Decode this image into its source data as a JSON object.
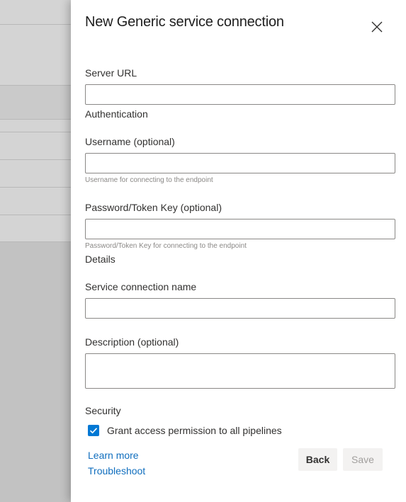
{
  "dialog": {
    "title": "New Generic service connection",
    "close_icon": "close-icon"
  },
  "fields": {
    "server_url": {
      "label": "Server URL",
      "value": ""
    },
    "authentication_section": "Authentication",
    "username": {
      "label": "Username (optional)",
      "value": "",
      "hint": "Username for connecting to the endpoint"
    },
    "password": {
      "label": "Password/Token Key (optional)",
      "value": "",
      "hint": "Password/Token Key for connecting to the endpoint"
    },
    "details_section": "Details",
    "connection_name": {
      "label": "Service connection name",
      "value": ""
    },
    "description": {
      "label": "Description (optional)",
      "value": ""
    }
  },
  "security": {
    "section": "Security",
    "grant_access": {
      "label": "Grant access permission to all pipelines",
      "checked": true
    }
  },
  "links": {
    "learn_more": "Learn more",
    "troubleshoot": "Troubleshoot"
  },
  "buttons": {
    "back": "Back",
    "save": "Save"
  },
  "colors": {
    "accent": "#0078d4",
    "link": "#106ebe",
    "brand_strip": "#5c2d91"
  }
}
